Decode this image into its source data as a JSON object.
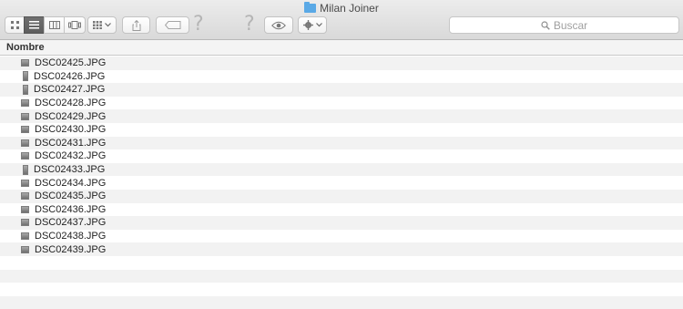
{
  "window": {
    "title": "Milan Joiner"
  },
  "toolbar": {
    "search_placeholder": "Buscar"
  },
  "list": {
    "header": "Nombre",
    "files": [
      {
        "name": "DSC02425.JPG",
        "orient": "landscape"
      },
      {
        "name": "DSC02426.JPG",
        "orient": "portrait"
      },
      {
        "name": "DSC02427.JPG",
        "orient": "portrait"
      },
      {
        "name": "DSC02428.JPG",
        "orient": "landscape"
      },
      {
        "name": "DSC02429.JPG",
        "orient": "landscape"
      },
      {
        "name": "DSC02430.JPG",
        "orient": "landscape"
      },
      {
        "name": "DSC02431.JPG",
        "orient": "landscape"
      },
      {
        "name": "DSC02432.JPG",
        "orient": "landscape"
      },
      {
        "name": "DSC02433.JPG",
        "orient": "portrait"
      },
      {
        "name": "DSC02434.JPG",
        "orient": "landscape"
      },
      {
        "name": "DSC02435.JPG",
        "orient": "landscape"
      },
      {
        "name": "DSC02436.JPG",
        "orient": "landscape"
      },
      {
        "name": "DSC02437.JPG",
        "orient": "landscape"
      },
      {
        "name": "DSC02438.JPG",
        "orient": "landscape"
      },
      {
        "name": "DSC02439.JPG",
        "orient": "landscape"
      }
    ]
  },
  "colors": {
    "folder": "#5aa9e6",
    "active_segment": "#5e5e5e"
  }
}
